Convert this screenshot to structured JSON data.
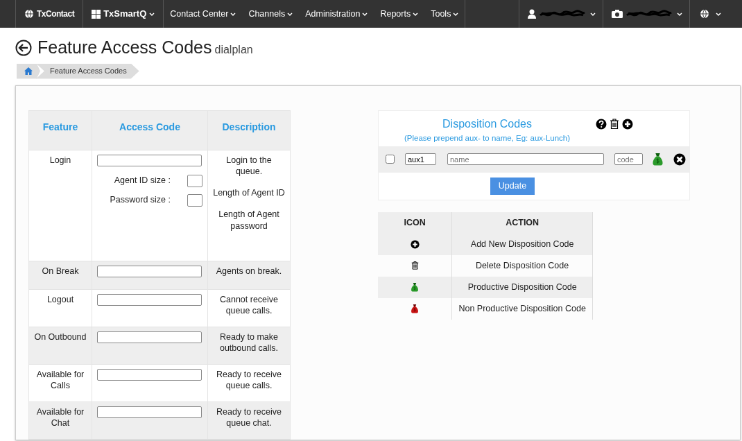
{
  "navbar": {
    "brand": "TxContact",
    "app": "TxSmartQ",
    "menus": [
      "Contact Center",
      "Channels",
      "Administration",
      "Reports",
      "Tools"
    ]
  },
  "page": {
    "title": "Feature Access Codes",
    "subtitle": "dialplan"
  },
  "breadcrumb": [
    "Feature Access Codes"
  ],
  "features": {
    "columns": [
      "Feature",
      "Access Code",
      "Description"
    ],
    "rows": [
      {
        "feature": "Login",
        "extra_fields": [
          {
            "label": "Agent ID size :"
          },
          {
            "label": "Password size :"
          }
        ],
        "description": [
          "Login to the queue.",
          "Length of Agent ID",
          "Length of Agent password"
        ]
      },
      {
        "feature": "On Break",
        "description": [
          "Agents on break."
        ]
      },
      {
        "feature": "Logout",
        "description": [
          "Cannot receive queue calls."
        ]
      },
      {
        "feature": "On Outbound",
        "description": [
          "Ready to make outbound calls."
        ]
      },
      {
        "feature": "Available for Calls",
        "description": [
          "Ready to receive queue calls."
        ]
      },
      {
        "feature": "Available for Chat",
        "description": [
          "Ready to receive queue chat."
        ]
      }
    ]
  },
  "disposition": {
    "title": "Disposition Codes",
    "hint": "(Please prepend aux- to name, Eg: aux-Lunch)",
    "rows": [
      {
        "checked": false,
        "aux": "aux1",
        "name_placeholder": "name",
        "code_placeholder": "code",
        "productive": true
      }
    ],
    "button": "Update"
  },
  "legend": {
    "columns": [
      "ICON",
      "ACTION"
    ],
    "rows": [
      {
        "kind": "add",
        "action": "Add New Disposition Code"
      },
      {
        "kind": "delete",
        "action": "Delete Disposition Code"
      },
      {
        "kind": "productive",
        "action": "Productive Disposition Code"
      },
      {
        "kind": "nonproductive",
        "action": "Non Productive Disposition Code"
      }
    ]
  }
}
